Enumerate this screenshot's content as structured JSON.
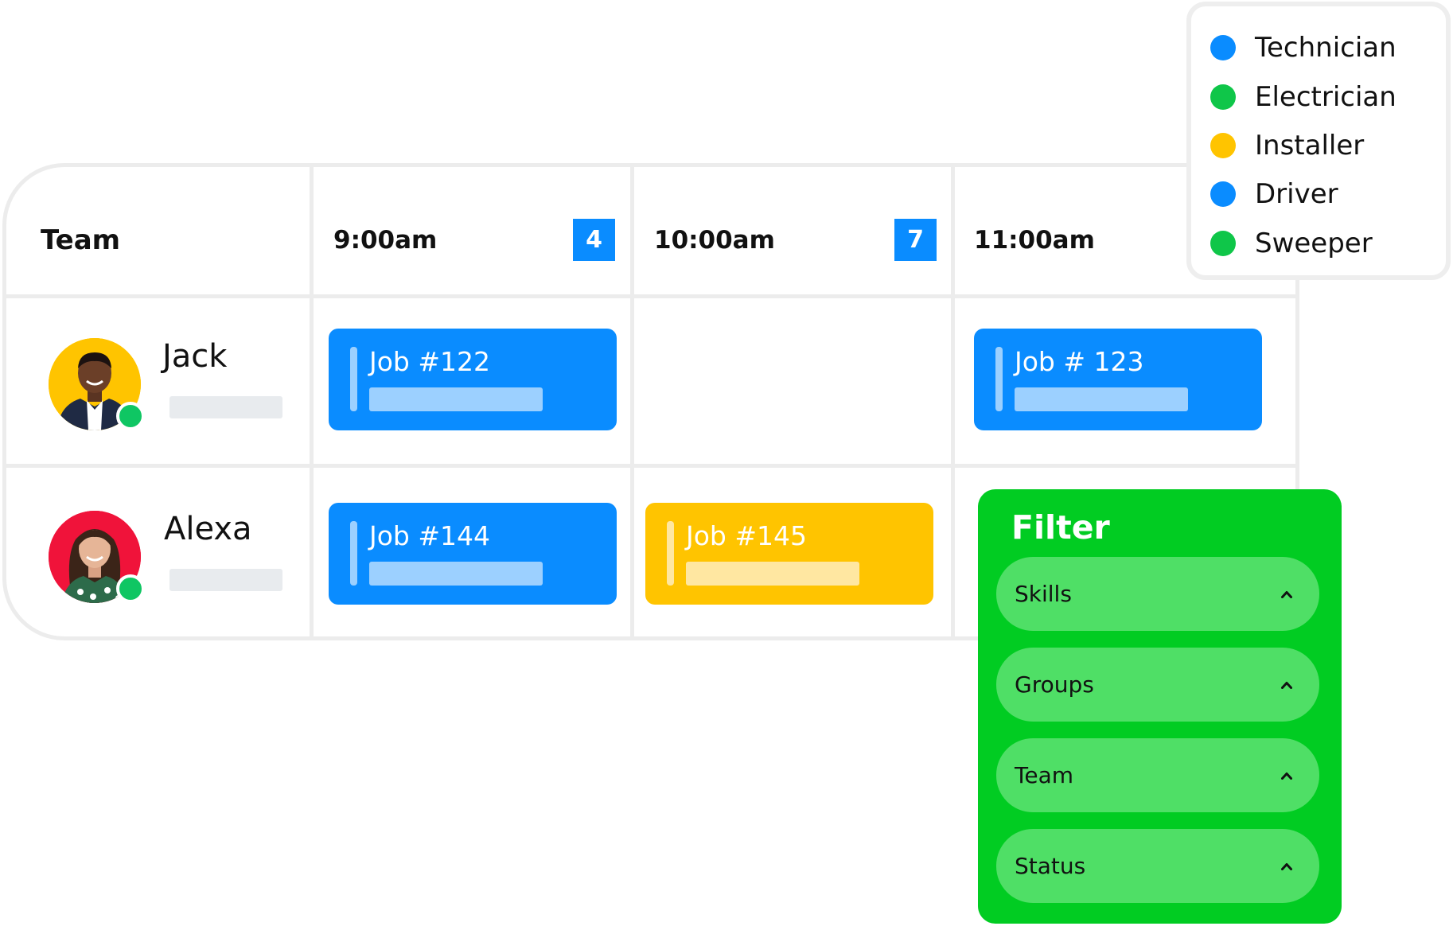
{
  "schedule": {
    "team_header": "Team",
    "time_slots": [
      {
        "label": "9:00am",
        "count": "4"
      },
      {
        "label": "10:00am",
        "count": "7"
      },
      {
        "label": "11:00am"
      }
    ],
    "members": [
      {
        "name": "Jack",
        "avatar_color": "#ffc400",
        "status": "online",
        "jobs": [
          {
            "slot": 0,
            "label": "Job #122",
            "color": "blue"
          },
          {
            "slot": 2,
            "label": "Job # 123",
            "color": "blue"
          }
        ]
      },
      {
        "name": "Alexa",
        "avatar_color": "#f0133a",
        "status": "online",
        "jobs": [
          {
            "slot": 0,
            "label": "Job #144",
            "color": "blue"
          },
          {
            "slot": 1,
            "label": "Job #145",
            "color": "yellow"
          }
        ]
      }
    ]
  },
  "legend": {
    "items": [
      {
        "label": "Technician",
        "color": "#0a8cff"
      },
      {
        "label": "Electrician",
        "color": "#0fc649"
      },
      {
        "label": "Installer",
        "color": "#ffc400"
      },
      {
        "label": "Driver",
        "color": "#0a8cff"
      },
      {
        "label": "Sweeper",
        "color": "#0fc649"
      }
    ]
  },
  "filter": {
    "title": "Filter",
    "options": [
      {
        "label": "Skills",
        "icon": "chevron-up-icon"
      },
      {
        "label": "Groups",
        "icon": "chevron-up-icon"
      },
      {
        "label": "Team",
        "icon": "chevron-up-icon"
      },
      {
        "label": "Status",
        "icon": "chevron-up-icon"
      }
    ]
  },
  "colors": {
    "job_blue": "#0a8cff",
    "job_yellow": "#ffc400",
    "filter_green": "#01cc22",
    "online_green": "#0fc663"
  }
}
